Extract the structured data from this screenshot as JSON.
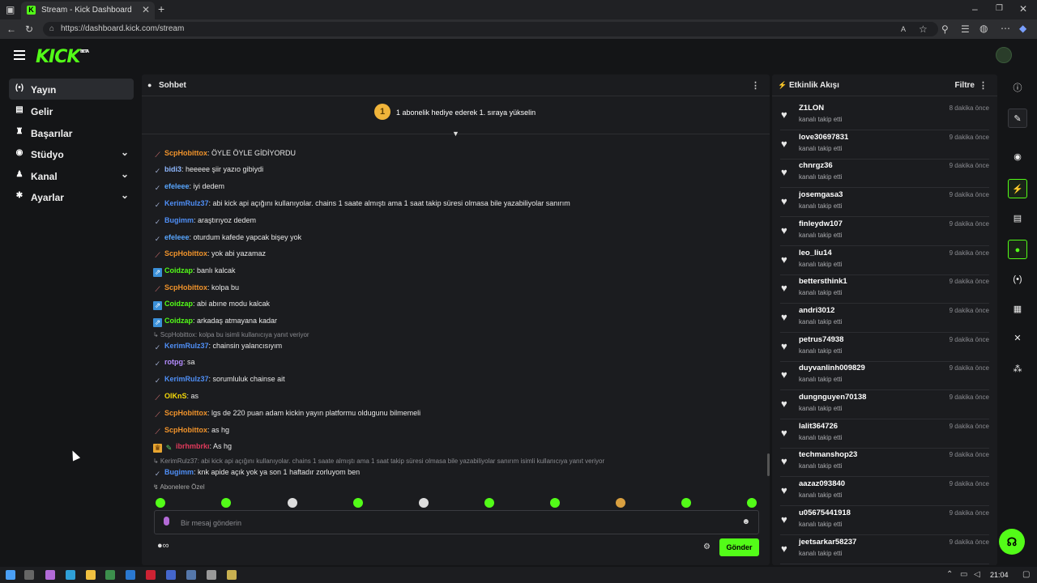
{
  "browser": {
    "tab_title": "Stream - Kick Dashboard",
    "url": "https://dashboard.kick.com/stream",
    "new_tab": "+"
  },
  "app": {
    "logo": "KICK",
    "logo_badge": "BETA"
  },
  "sidebar": {
    "items": [
      {
        "label": "Yayın",
        "icon": "broadcast-icon",
        "glyph": "(•)",
        "active": true
      },
      {
        "label": "Gelir",
        "icon": "wallet-icon",
        "glyph": "▤"
      },
      {
        "label": "Başarılar",
        "icon": "trophy-icon",
        "glyph": "♜"
      },
      {
        "label": "Stüdyo",
        "icon": "camera-icon",
        "glyph": "◉",
        "expandable": true
      },
      {
        "label": "Kanal",
        "icon": "users-icon",
        "glyph": "♟",
        "expandable": true
      },
      {
        "label": "Ayarlar",
        "icon": "gear-icon",
        "glyph": "✱",
        "expandable": true
      }
    ]
  },
  "chat": {
    "title": "Sohbet",
    "pinned_badge": "1",
    "pinned_text": "1 abonelik hediye ederek 1. sıraya yükselin",
    "messages": [
      {
        "badge": "sword",
        "user": "ScpHobittox",
        "color": "#f0932b",
        "text": ": ÖYLE ÖYLE GİDİYORDU"
      },
      {
        "badge": "check",
        "user": "bidi3",
        "color": "#8fb8ff",
        "text": ": heeeee şiir yazıo gibiydi"
      },
      {
        "badge": "check",
        "user": "efeleee",
        "color": "#58a6ff",
        "text": ": iyi dedem"
      },
      {
        "badge": "check",
        "user": "KerimRulz37",
        "color": "#4f8ff7",
        "text": ": abi kick api açığını kullanıyolar. chains 1 saate almıştı ama 1 saat takip süresi olmasa bile yazabiliyolar sanırım"
      },
      {
        "badge": "check",
        "user": "Bugimm",
        "color": "#4f8ff7",
        "text": ": araştırıyoz dedem"
      },
      {
        "badge": "check",
        "user": "efeleee",
        "color": "#58a6ff",
        "text": ": oturdum kafede yapcak bişey yok"
      },
      {
        "badge": "sword",
        "user": "ScpHobittox",
        "color": "#f0932b",
        "text": ": yok abi yazamaz"
      },
      {
        "badge": "boost",
        "user": "Coidzap",
        "color": "#53fc18",
        "text": ": banlı kalcak"
      },
      {
        "badge": "sword",
        "user": "ScpHobittox",
        "color": "#f0932b",
        "text": ": kolpa bu"
      },
      {
        "badge": "boost",
        "user": "Coidzap",
        "color": "#53fc18",
        "text": ": abi abıne modu kalcak"
      },
      {
        "badge": "boost",
        "user": "Coidzap",
        "color": "#53fc18",
        "text": ": arkadaş atmayana kadar"
      },
      {
        "reply": "↳ ScpHobittox: kolpa bu isimli kullanıcıya yanıt veriyor",
        "badge": "check",
        "user": "KerimRulz37",
        "color": "#4f8ff7",
        "text": ": chainsin yalancısıyım"
      },
      {
        "badge": "check",
        "user": "rotpg",
        "color": "#b48cff",
        "text": ": sa"
      },
      {
        "badge": "check",
        "user": "KerimRulz37",
        "color": "#4f8ff7",
        "text": ": sorumluluk chainse ait"
      },
      {
        "badge": "sword",
        "user": "OlKnS",
        "color": "#f5d90a",
        "text": ": as"
      },
      {
        "badge": "sword",
        "user": "ScpHobittox",
        "color": "#f0932b",
        "text": ": lgs de 220 puan adam kickin yayın platformu oldugunu bilmemeli"
      },
      {
        "badge": "sword",
        "user": "ScpHobittox",
        "color": "#f0932b",
        "text": ": as hg"
      },
      {
        "badge": "crown",
        "badge2": "pen",
        "user": "ibrhmbrkı",
        "color": "#e03a5c",
        "text": ": As hg"
      },
      {
        "reply": "↳ KerimRulz37: abi kick api açığını kullanıyolar. chains 1 saate almıştı ama 1 saat takip süresi olmasa bile yazabiliyolar sanırım isimli kullanıcıya yanıt veriyor",
        "badge": "check",
        "user": "Bugimm",
        "color": "#4f8ff7",
        "text": ": knk apide açık yok ya son 1 haftadır zorluyom ben"
      }
    ],
    "subs_label": "↯ Abonelere Özel",
    "input_placeholder": "Bir mesaj gönderin",
    "send_label": "Gönder"
  },
  "activity": {
    "title": "Etkinlik Akışı",
    "filter_label": "Filtre",
    "events": [
      {
        "user": "Z1LON",
        "action": "kanalı takip etti",
        "time": "8 dakika önce"
      },
      {
        "user": "love30697831",
        "action": "kanalı takip etti",
        "time": "9 dakika önce"
      },
      {
        "user": "chnrgz36",
        "action": "kanalı takip etti",
        "time": "9 dakika önce"
      },
      {
        "user": "josemgasa3",
        "action": "kanalı takip etti",
        "time": "9 dakika önce"
      },
      {
        "user": "finleydw107",
        "action": "kanalı takip etti",
        "time": "9 dakika önce"
      },
      {
        "user": "leo_liu14",
        "action": "kanalı takip etti",
        "time": "9 dakika önce"
      },
      {
        "user": "bettersthink1",
        "action": "kanalı takip etti",
        "time": "9 dakika önce"
      },
      {
        "user": "andri3012",
        "action": "kanalı takip etti",
        "time": "9 dakika önce"
      },
      {
        "user": "petrus74938",
        "action": "kanalı takip etti",
        "time": "9 dakika önce"
      },
      {
        "user": "duyvanlinh009829",
        "action": "kanalı takip etti",
        "time": "9 dakika önce"
      },
      {
        "user": "dungnguyen70138",
        "action": "kanalı takip etti",
        "time": "9 dakika önce"
      },
      {
        "user": "lalit364726",
        "action": "kanalı takip etti",
        "time": "9 dakika önce"
      },
      {
        "user": "techmanshop23",
        "action": "kanalı takip etti",
        "time": "9 dakika önce"
      },
      {
        "user": "aazaz093840",
        "action": "kanalı takip etti",
        "time": "9 dakika önce"
      },
      {
        "user": "u05675441918",
        "action": "kanalı takip etti",
        "time": "9 dakika önce"
      },
      {
        "user": "jeetsarkar58237",
        "action": "kanalı takip etti",
        "time": "9 dakika önce"
      }
    ]
  },
  "taskbar": {
    "time": "21:04"
  },
  "colors": {
    "accent": "#53fc18",
    "panel": "#1b1c1f",
    "background": "#141517"
  }
}
